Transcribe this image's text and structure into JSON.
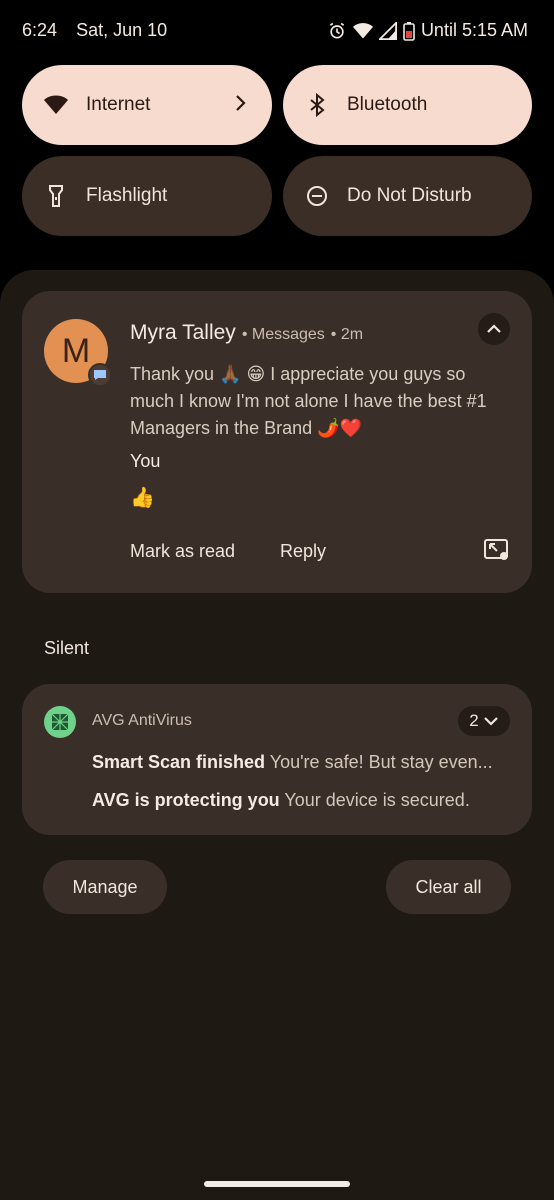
{
  "status": {
    "time": "6:24",
    "date": "Sat, Jun 10",
    "battery_text": "Until 5:15 AM"
  },
  "quick_tiles": [
    {
      "label": "Internet",
      "icon": "wifi-icon",
      "active": true
    },
    {
      "label": "Bluetooth",
      "icon": "bluetooth-icon",
      "active": true
    },
    {
      "label": "Flashlight",
      "icon": "flashlight-icon",
      "active": false
    },
    {
      "label": "Do Not Disturb",
      "icon": "dnd-icon",
      "active": false
    }
  ],
  "message": {
    "avatar_letter": "M",
    "sender": "Myra Talley",
    "app": "• Messages",
    "time": "• 2m",
    "text": "Thank you 🙏🏾 😁 I appreciate you guys so much I know I'm not alone I have the best #1 Managers in the Brand 🌶️❤️",
    "reply_author": "You",
    "reply_text": "👍",
    "action_read": "Mark as read",
    "action_reply": "Reply"
  },
  "silent_label": "Silent",
  "avg": {
    "app_name": "AVG AntiVirus",
    "count": "2",
    "line1_title": "Smart Scan finished",
    "line1_text": "You're safe! But stay even...",
    "line2_title": "AVG is protecting you",
    "line2_text": "Your device is secured."
  },
  "buttons": {
    "manage": "Manage",
    "clear_all": "Clear all"
  },
  "colors": {
    "tile_on": "#f7dbcf",
    "tile_off": "#3a2e27",
    "panel": "#1f1914",
    "card": "#3a2f28",
    "avatar": "#e29152",
    "avg_icon": "#6fd18a"
  }
}
